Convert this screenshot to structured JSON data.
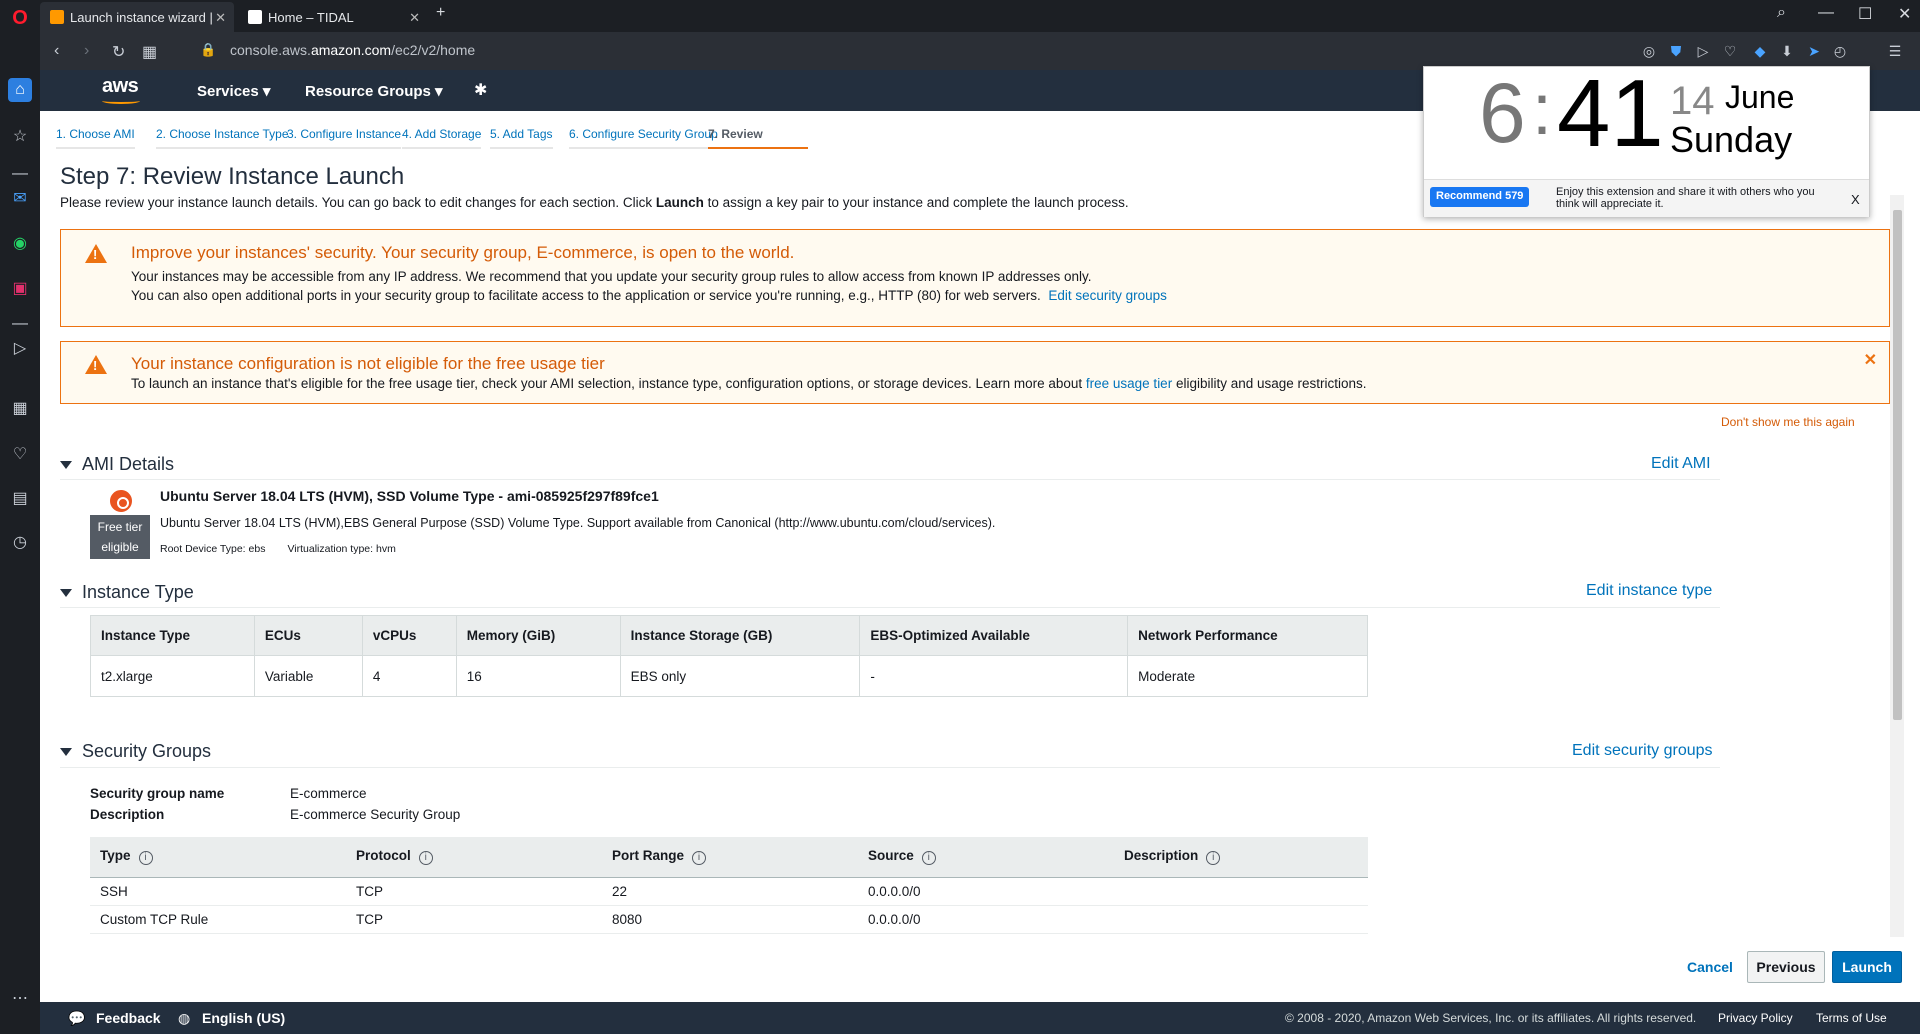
{
  "browser": {
    "tabs": [
      {
        "label": "Launch instance wizard | ",
        "active": true
      },
      {
        "label": "Home – TIDAL",
        "active": false
      }
    ],
    "url_prefix": "console.aws.",
    "url_domain": "amazon.com",
    "url_path": "/ec2/v2/home"
  },
  "aws": {
    "logo": "aws",
    "services": "Services",
    "resource_groups": "Resource Groups"
  },
  "steps": [
    {
      "label": "1. Choose AMI"
    },
    {
      "label": "2. Choose Instance Type"
    },
    {
      "label": "3. Configure Instance"
    },
    {
      "label": "4. Add Storage"
    },
    {
      "label": "5. Add Tags"
    },
    {
      "label": "6. Configure Security Group"
    },
    {
      "label": "7. Review"
    }
  ],
  "page": {
    "title": "Step 7: Review Instance Launch",
    "intro_a": "Please review your instance launch details. You can go back to edit changes for each section. Click ",
    "intro_bold": "Launch",
    "intro_b": " to assign a key pair to your instance and complete the launch process."
  },
  "alert1": {
    "title": "Improve your instances' security. Your security group, E-commerce, is open to the world.",
    "line1": "Your instances may be accessible from any IP address. We recommend that you update your security group rules to allow access from known IP addresses only.",
    "line2": "You can also open additional ports in your security group to facilitate access to the application or service you're running, e.g., HTTP (80) for web servers.",
    "link": "Edit security groups"
  },
  "alert2": {
    "title": "Your instance configuration is not eligible for the free usage tier",
    "line_a": "To launch an instance that's eligible for the free usage tier, check your AMI selection, instance type, configuration options, or storage devices. Learn more about ",
    "link": "free usage tier",
    "line_b": " eligibility and usage restrictions.",
    "dont_show": "Don't show me this again"
  },
  "ami": {
    "heading": "AMI Details",
    "edit": "Edit AMI",
    "name": "Ubuntu Server 18.04 LTS (HVM), SSD Volume Type - ami-085925f297f89fce1",
    "description": "Ubuntu Server 18.04 LTS (HVM),EBS General Purpose (SSD) Volume Type. Support available from Canonical (http://www.ubuntu.com/cloud/services).",
    "root_device": "Root Device Type: ebs",
    "virtualization": "Virtualization type: hvm",
    "badge_line1": "Free tier",
    "badge_line2": "eligible"
  },
  "instance_type": {
    "heading": "Instance Type",
    "edit": "Edit instance type",
    "headers": [
      "Instance Type",
      "ECUs",
      "vCPUs",
      "Memory (GiB)",
      "Instance Storage (GB)",
      "EBS-Optimized Available",
      "Network Performance"
    ],
    "row": [
      "t2.xlarge",
      "Variable",
      "4",
      "16",
      "EBS only",
      "-",
      "Moderate"
    ]
  },
  "security_groups": {
    "heading": "Security Groups",
    "edit": "Edit security groups",
    "name_label": "Security group name",
    "name_value": "E-commerce",
    "desc_label": "Description",
    "desc_value": "E-commerce Security Group",
    "headers": [
      "Type",
      "Protocol",
      "Port Range",
      "Source",
      "Description"
    ],
    "rows": [
      [
        "SSH",
        "TCP",
        "22",
        "0.0.0.0/0",
        ""
      ],
      [
        "Custom TCP Rule",
        "TCP",
        "8080",
        "0.0.0.0/0",
        ""
      ]
    ]
  },
  "buttons": {
    "cancel": "Cancel",
    "previous": "Previous",
    "launch": "Launch"
  },
  "footer": {
    "feedback": "Feedback",
    "language": "English (US)",
    "copyright": "© 2008 - 2020, Amazon Web Services, Inc. or its affiliates. All rights reserved.",
    "privacy": "Privacy Policy",
    "terms": "Terms of Use"
  },
  "clock": {
    "hour": "6",
    "colon": ":",
    "minute": "41",
    "day": "14",
    "month": "June",
    "weekday": "Sunday",
    "recommend": "Recommend 579",
    "enjoy": "Enjoy this extension and share it with others who you think will appreciate it.",
    "close": "X"
  },
  "colors": {
    "aws_header": "#232f3e",
    "aws_orange": "#ec7211",
    "link_blue": "#0073bb"
  }
}
